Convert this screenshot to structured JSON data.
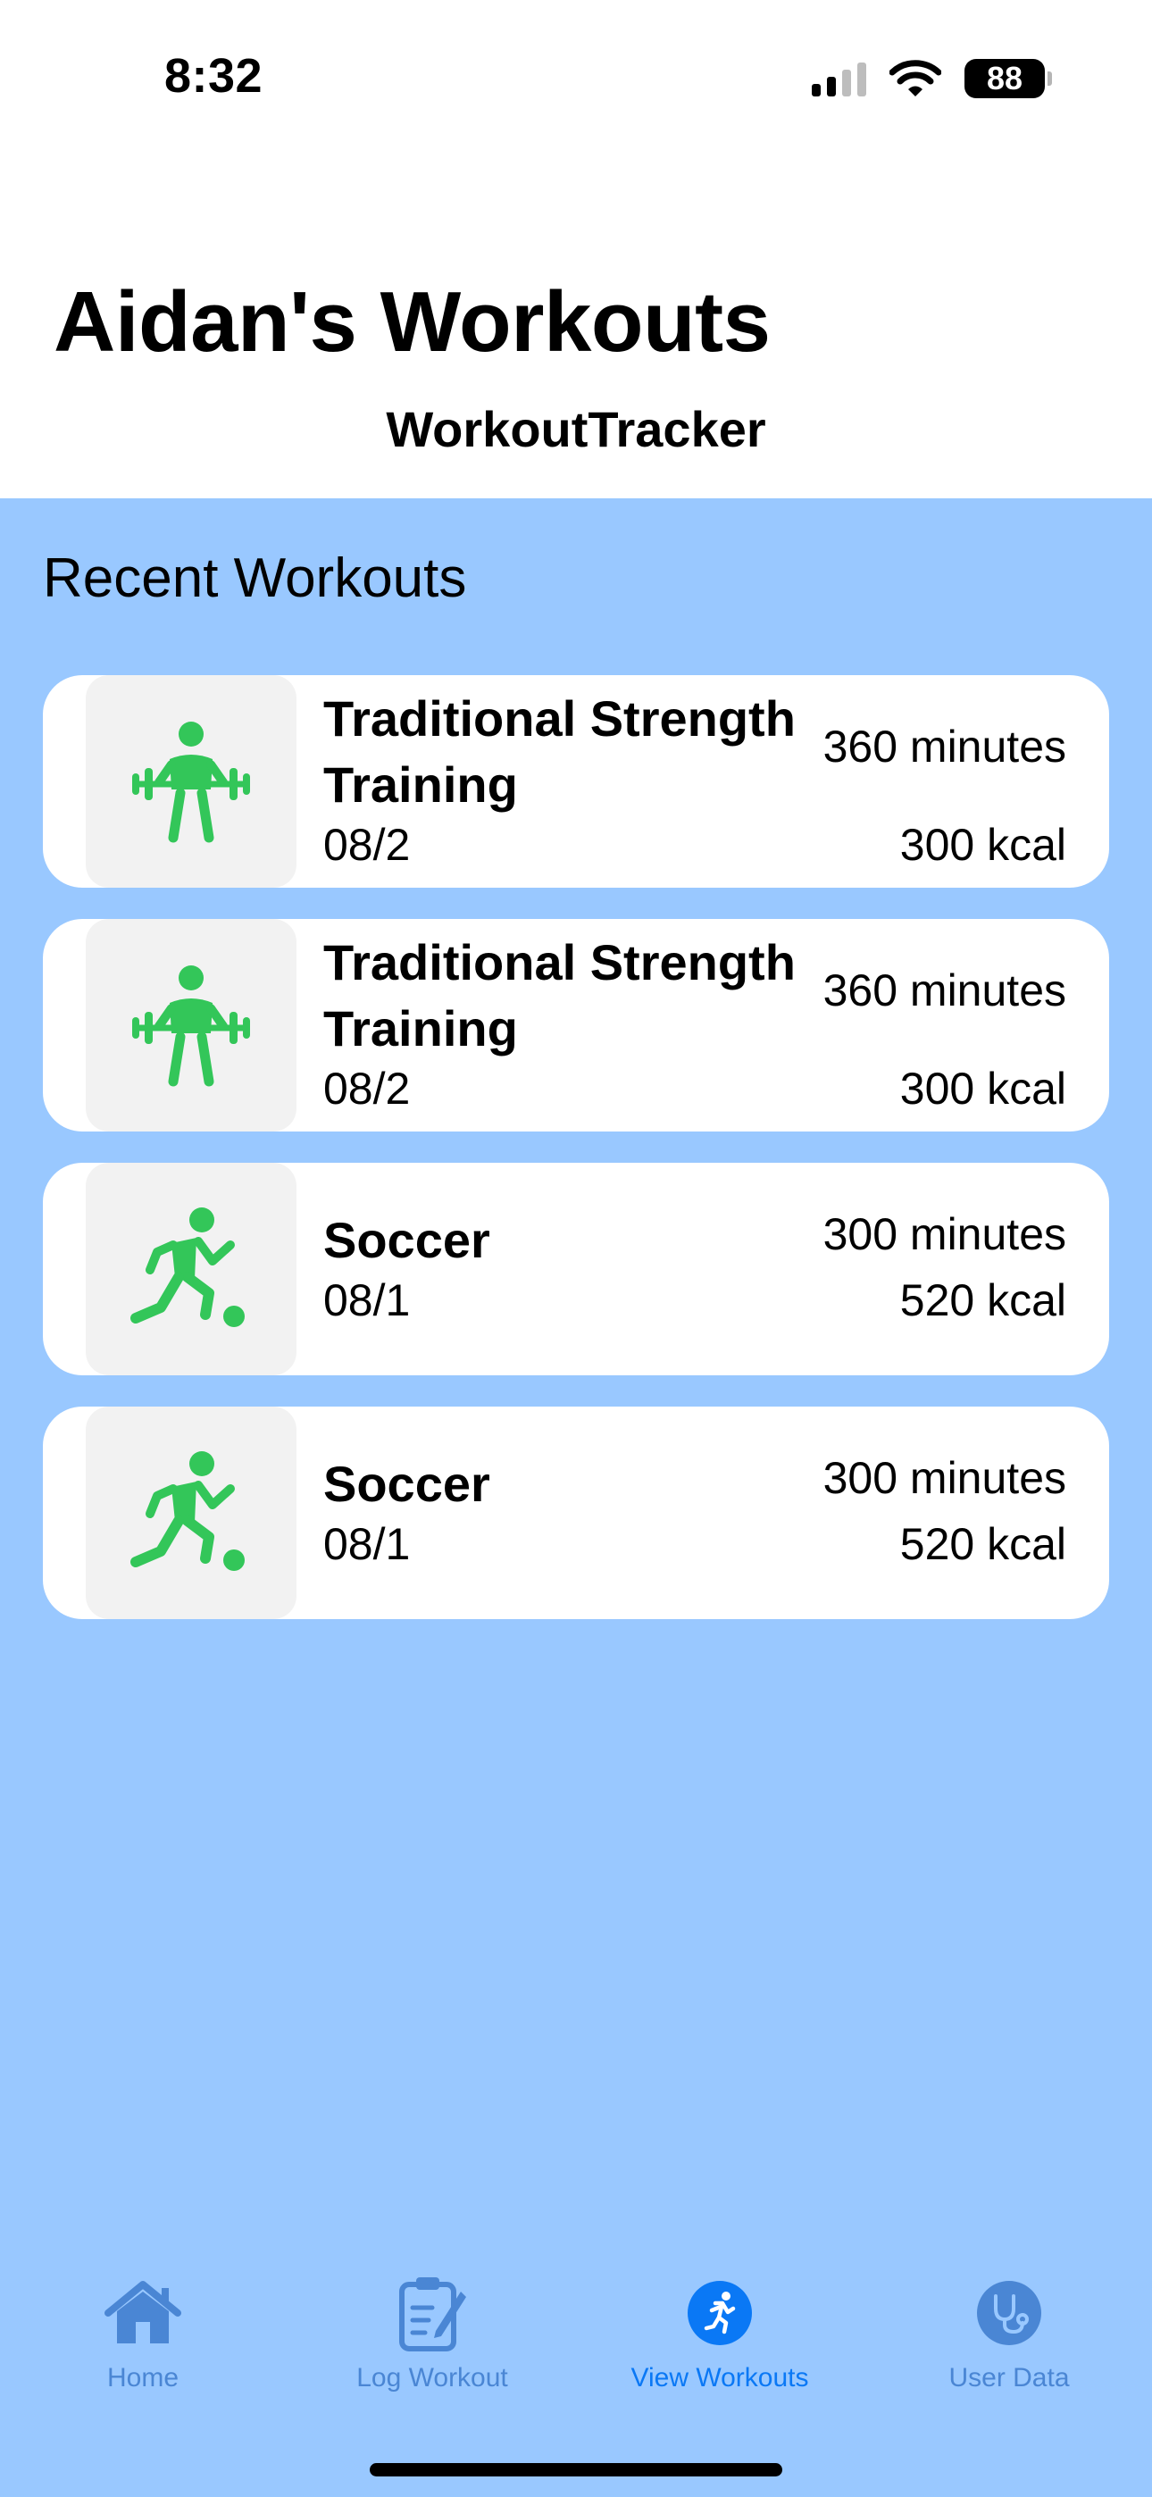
{
  "status_bar": {
    "time": "8:32",
    "battery": "88"
  },
  "header": {
    "title": "Aidan's Workouts",
    "app_name": "WorkoutTracker"
  },
  "section": {
    "title": "Recent Workouts"
  },
  "workouts": [
    {
      "icon": "weightlifting-icon",
      "name": "Traditional Strength Training",
      "date": "08/2",
      "duration": "360 minutes",
      "calories": "300 kcal"
    },
    {
      "icon": "weightlifting-icon",
      "name": "Traditional Strength Training",
      "date": "08/2",
      "duration": "360 minutes",
      "calories": "300 kcal"
    },
    {
      "icon": "soccer-player-icon",
      "name": "Soccer",
      "date": "08/1",
      "duration": "300 minutes",
      "calories": "520 kcal"
    },
    {
      "icon": "soccer-player-icon",
      "name": "Soccer",
      "date": "08/1",
      "duration": "300 minutes",
      "calories": "520 kcal"
    }
  ],
  "tabs": [
    {
      "label": "Home",
      "icon": "house-icon"
    },
    {
      "label": "Log Workout",
      "icon": "clipboard-pencil-icon"
    },
    {
      "label": "View Workouts",
      "icon": "running-figure-icon",
      "active": true
    },
    {
      "label": "User Data",
      "icon": "stethoscope-icon"
    }
  ],
  "colors": {
    "background": "#99c8ff",
    "card": "#ffffff",
    "icon_box": "#f2f2f2",
    "activity_icon": "#33c659",
    "tab_active": "#0a78f5",
    "tab_inactive": "#4a86d4"
  }
}
